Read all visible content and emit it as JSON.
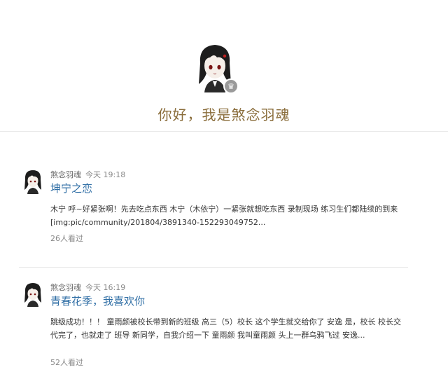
{
  "profile": {
    "greeting": "你好，我是煞念羽魂",
    "avatar_icon": "anime-girl-avatar",
    "badge_icon": "crown-badge-icon"
  },
  "posts": [
    {
      "author": "煞念羽魂",
      "time": "今天 19:18",
      "title": "坤宁之恋",
      "excerpt": "木宁 呼~好紧张啊！先去吃点东西 木宁（木依宁）一紧张就想吃东西 录制现场 练习生们都陆续的到来 [img:pic/community/201804/3891340-152293049752...",
      "views": "26人看过"
    },
    {
      "author": "煞念羽魂",
      "time": "今天 16:19",
      "title": "青春花季，我喜欢你",
      "excerpt": "跳级成功！！！ 童雨颜被校长带到新的班级 高三（5）校长 这个学生就交给你了 安逸 是，校长 校长交代完了，也就走了 班导 新同学，自我介绍一下 童雨颜 我叫童雨颜 头上一群乌鸦飞过 安逸...",
      "views": "52人看过"
    }
  ],
  "colors": {
    "greeting": "#8a6d3b",
    "title_link": "#2f6ea5",
    "meta": "#888888"
  }
}
